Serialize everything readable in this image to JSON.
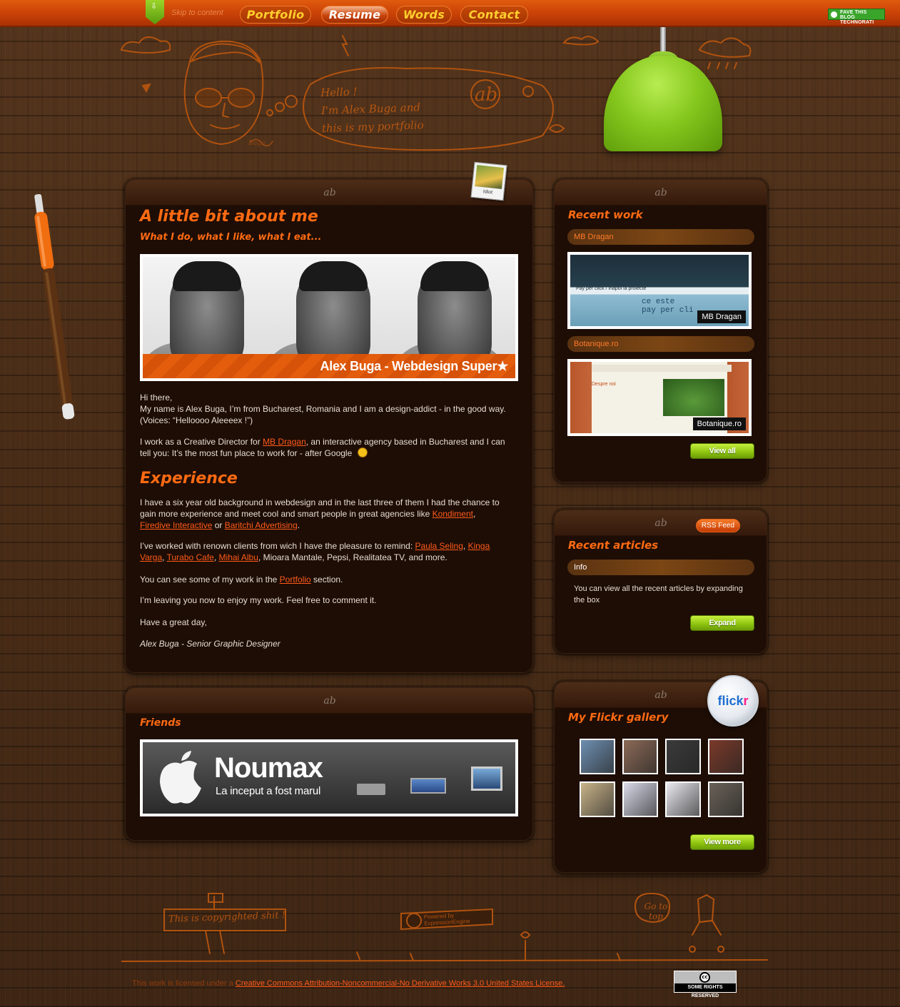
{
  "topbar": {
    "skip_label": "Skip to content",
    "nav": [
      {
        "label": "Portfolio",
        "active": false
      },
      {
        "label": "Resume",
        "active": true
      },
      {
        "label": "Words",
        "active": false
      },
      {
        "label": "Contact",
        "active": false
      }
    ],
    "technorati_line1": "FAVE THIS BLOG",
    "technorati_line2": "TECHNORATI"
  },
  "header": {
    "bubble_text": "Hello !\nI'm Alex Buga and\nthis is my portfolio",
    "initials": "ab",
    "signature": "Buga"
  },
  "about": {
    "title": "A little bit about me",
    "subtitle": "What I do, what I like, what I eat...",
    "polaroid_label": "Idiot",
    "banner_text": "Alex Buga - Webdesign Super★",
    "intro_p1_a": "Hi there,",
    "intro_p1_b": "My name is Alex Buga, I’m from Bucharest, Romania and I am a design-addict - in the good way. (Voices: “Helloooo Aleeeex !”)",
    "intro_p2_a": "I work as a Creative Director for ",
    "intro_p2_link": "MB Dragan",
    "intro_p2_b": ", an interactive agency based in Bucharest and I can tell you: It’s the most fun place to work for - after Google",
    "experience_title": "Experience",
    "exp_p1_a": "I have a six year old background in webdesign and in the last three of them I had the chance to gain more experience and meet cool and smart people in great agencies like ",
    "exp_p1_link1": "Kondiment",
    "exp_p1_sep": ",",
    "exp_p1_link2": "Firedive Interactive",
    "exp_p1_or": " or ",
    "exp_p1_link3": "Baritchi Advertising",
    "exp_p1_end": ".",
    "exp_p2_a": "I’ve worked with renown clients from wich I have the pleasure to remind: ",
    "exp_p2_link1": "Paula Seling",
    "exp_p2_link2": "Kinga Varga",
    "exp_p2_link3": "Turabo Cafe",
    "exp_p2_link4": "Mihai Albu",
    "exp_p2_end": ", Mioara Mantale, Pepsi, Realitatea TV, and more.",
    "exp_p3_a": "You can see some of my work in the ",
    "exp_p3_link": "Portfolio",
    "exp_p3_b": " section.",
    "exp_p4": "I’m leaving you now to enjoy my work. Feel free to comment it.",
    "exp_p5": "Have a great day,",
    "signature": "Alex Buga - Senior Graphic Designer"
  },
  "friends": {
    "title": "Friends",
    "banner_title": "Noumax",
    "banner_sub": "La inceput a fost marul"
  },
  "recent_work": {
    "title": "Recent work",
    "items": [
      {
        "label": "MB Dragan",
        "caption": "MB Dragan",
        "shot_text1": "Pay per click / inapoi la proiecte",
        "shot_text2": "ce este",
        "shot_text3": "pay per cli"
      },
      {
        "label": "Botanique.ro",
        "caption": "Botanique.ro",
        "shot_text1": "Despre noi"
      }
    ],
    "view_all": "View all"
  },
  "recent_articles": {
    "rss": "RSS Feed",
    "title": "Recent articles",
    "info_label": "Info",
    "info_text": "You can view all the recent articles by expanding the box",
    "expand": "Expand"
  },
  "flickr": {
    "title": "My Flickr gallery",
    "badge": "flickr",
    "view_more": "View more",
    "thumb_colors": [
      "#6e8fb0",
      "#8b6a57",
      "#3a3a3a",
      "#7a3a2a",
      "#c9b48a",
      "#d9d9e9",
      "#e9e9ef",
      "#6a6258"
    ]
  },
  "footer": {
    "sign": "This is copyrighted shit !",
    "powered": "Powered by ExpressionEngine",
    "go_top": "Go to top",
    "license_prefix": "This work is licensed under a ",
    "license_link": "Creative Commons Attribution-Noncommercial-No Derivative Works 3.0 United States License.",
    "cc_label": "SOME RIGHTS RESERVED",
    "cc_icon": "cc"
  }
}
